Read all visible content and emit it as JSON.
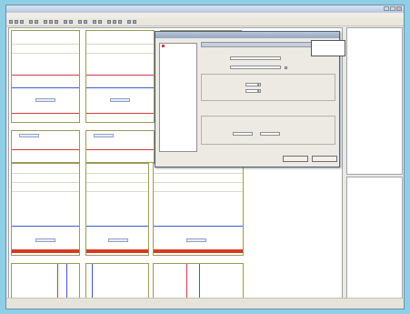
{
  "app": {
    "title": "",
    "menu": [
      "",
      "",
      "",
      "",
      "",
      "",
      "",
      "",
      ""
    ]
  },
  "canvas": {
    "labels": [
      "",
      "",
      "",
      "",
      "",
      "",
      "",
      "",
      ""
    ]
  },
  "properties": {
    "rows": [
      "",
      "",
      "",
      "",
      "",
      "",
      "",
      ""
    ]
  },
  "tree": {
    "items": [
      "",
      "",
      "",
      ""
    ]
  },
  "dialog": {
    "title": "",
    "section_title": "",
    "list_items": [
      "",
      "",
      "",
      ""
    ],
    "labels": [
      "",
      "",
      "",
      "",
      "",
      "",
      "",
      "",
      "",
      "",
      ""
    ],
    "inputs": [
      "",
      "",
      "",
      "",
      "",
      ""
    ],
    "dropdown_options": [
      "",
      "",
      ""
    ],
    "ok_label": "",
    "cancel_label": ""
  },
  "status": {
    "left": "",
    "mid": "",
    "right": ""
  },
  "colors": {
    "desktop": "#8ecfe6",
    "accent_red": "#d43a3a",
    "accent_blue": "#3a5ad4",
    "bar_red": "#d63a22",
    "frame_olive": "#9a9a5a"
  },
  "icons": [
    "minimize-icon",
    "maximize-icon",
    "close-icon",
    "toolbar-tool-icon",
    "list-item-icon"
  ]
}
